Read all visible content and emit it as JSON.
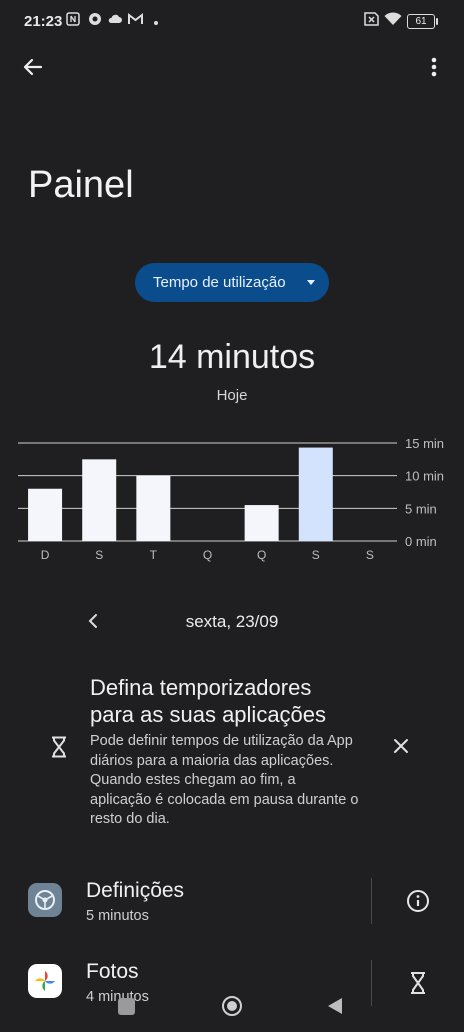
{
  "status_bar": {
    "time": "21:23",
    "battery": "61",
    "icons": [
      "nfc-icon",
      "chrome-icon",
      "cloud-icon",
      "gmail-icon",
      "dot-icon",
      "no-sim-icon",
      "wifi-icon",
      "battery-icon"
    ]
  },
  "page": {
    "title": "Painel",
    "dropdown_label": "Tempo de utilização",
    "total": "14 minutos",
    "period": "Hoje",
    "date": "sexta, 23/09"
  },
  "chart_data": {
    "type": "bar",
    "categories": [
      "D",
      "S",
      "T",
      "Q",
      "Q",
      "S",
      "S"
    ],
    "values": [
      8,
      12.5,
      10,
      0,
      5.5,
      14.3,
      0
    ],
    "y_ticks": [
      "15 min",
      "10 min",
      "5 min",
      "0 min"
    ],
    "ylim": [
      0,
      15
    ],
    "highlight_index": 5,
    "colors": {
      "bar": "#f4f6fb",
      "highlight": "#d3e3fd",
      "grid": "#d0d0d0",
      "label": "#bdbdbd"
    }
  },
  "tip": {
    "title": "Defina temporizadores para as suas aplicações",
    "body": "Pode definir tempos de utilização da App diários para a maioria das aplicações. Quando estes chegam ao fim, a aplicação é colocada em pausa durante o resto do dia."
  },
  "apps": [
    {
      "name": "Definições",
      "time": "5 minutos",
      "action_icon": "info-icon"
    },
    {
      "name": "Fotos",
      "time": "4 minutos",
      "action_icon": "hourglass-icon"
    }
  ],
  "colors": {
    "background": "#1f1f21",
    "accent": "#0b4d8c"
  }
}
